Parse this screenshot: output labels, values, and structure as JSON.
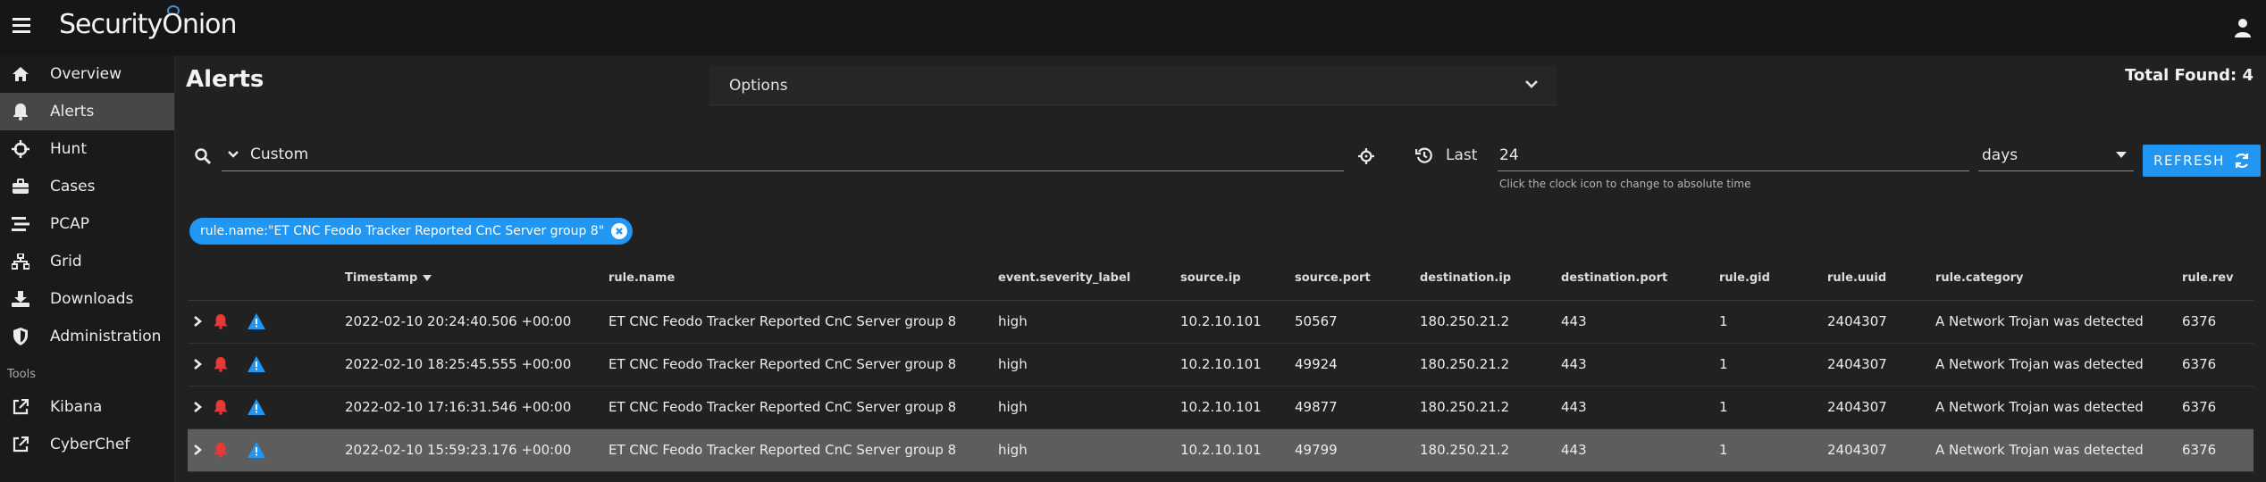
{
  "app": {
    "logo_text_1": "Security",
    "logo_text_2": "nion",
    "logo_o": "O"
  },
  "sidebar": {
    "items": [
      {
        "label": "Overview",
        "icon": "home-icon"
      },
      {
        "label": "Alerts",
        "icon": "bell-icon"
      },
      {
        "label": "Hunt",
        "icon": "crosshairs-icon"
      },
      {
        "label": "Cases",
        "icon": "briefcase-icon"
      },
      {
        "label": "PCAP",
        "icon": "stream-icon"
      },
      {
        "label": "Grid",
        "icon": "sitemap-icon"
      },
      {
        "label": "Downloads",
        "icon": "download-icon"
      },
      {
        "label": "Administration",
        "icon": "shield-icon"
      }
    ],
    "tools_label": "Tools",
    "tools": [
      {
        "label": "Kibana",
        "icon": "external-link-icon"
      },
      {
        "label": "CyberChef",
        "icon": "external-link-icon"
      }
    ]
  },
  "page": {
    "title": "Alerts",
    "total_found": "Total Found: 4",
    "options_label": "Options"
  },
  "search": {
    "query_value": "Custom",
    "last_label": "Last",
    "last_value": "24",
    "hint": "Click the clock icon to change to absolute time",
    "unit_value": "days",
    "refresh_label": "REFRESH"
  },
  "filter_chip": "rule.name:\"ET CNC Feodo Tracker Reported CnC Server group 8\"",
  "table": {
    "headers": [
      "Timestamp",
      "rule.name",
      "event.severity_label",
      "source.ip",
      "source.port",
      "destination.ip",
      "destination.port",
      "rule.gid",
      "rule.uuid",
      "rule.category",
      "rule.rev"
    ],
    "rows": [
      [
        "2022-02-10 20:24:40.506 +00:00",
        "ET CNC Feodo Tracker Reported CnC Server group 8",
        "high",
        "10.2.10.101",
        "50567",
        "180.250.21.2",
        "443",
        "1",
        "2404307",
        "A Network Trojan was detected",
        "6376"
      ],
      [
        "2022-02-10 18:25:45.555 +00:00",
        "ET CNC Feodo Tracker Reported CnC Server group 8",
        "high",
        "10.2.10.101",
        "49924",
        "180.250.21.2",
        "443",
        "1",
        "2404307",
        "A Network Trojan was detected",
        "6376"
      ],
      [
        "2022-02-10 17:16:31.546 +00:00",
        "ET CNC Feodo Tracker Reported CnC Server group 8",
        "high",
        "10.2.10.101",
        "49877",
        "180.250.21.2",
        "443",
        "1",
        "2404307",
        "A Network Trojan was detected",
        "6376"
      ],
      [
        "2022-02-10 15:59:23.176 +00:00",
        "ET CNC Feodo Tracker Reported CnC Server group 8",
        "high",
        "10.2.10.101",
        "49799",
        "180.250.21.2",
        "443",
        "1",
        "2404307",
        "A Network Trojan was detected",
        "6376"
      ]
    ]
  },
  "colors": {
    "accent": "#2196f3",
    "alarm": "#e53935",
    "warning_icon": "#2196f3"
  }
}
